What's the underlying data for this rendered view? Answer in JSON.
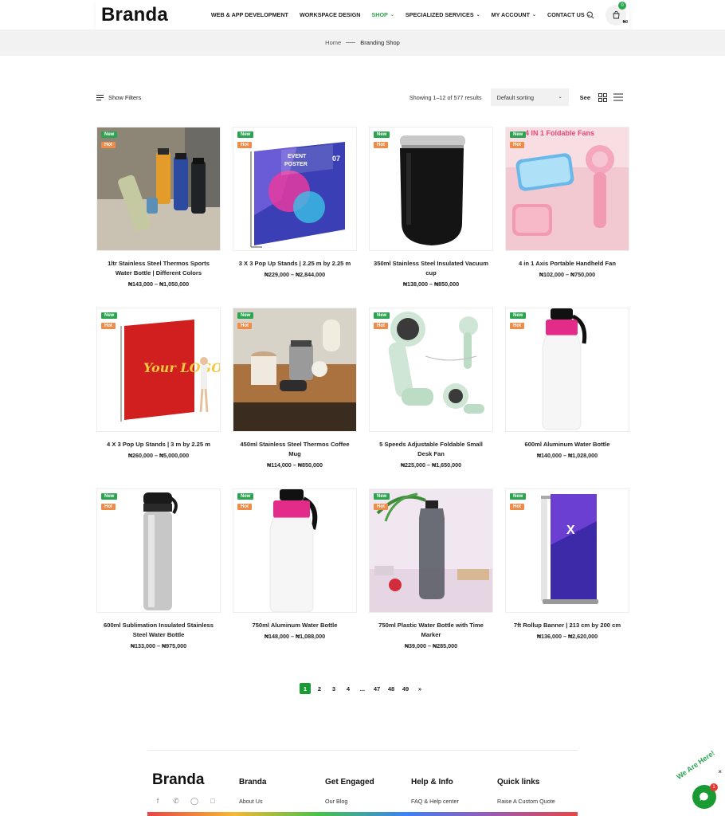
{
  "header": {
    "logo": "Branda",
    "nav": [
      {
        "label": "WEB & APP DEVELOPMENT",
        "dropdown": false,
        "active": false
      },
      {
        "label": "WORKSPACE DESIGN",
        "dropdown": false,
        "active": false
      },
      {
        "label": "SHOP",
        "dropdown": true,
        "active": true
      },
      {
        "label": "SPECIALIZED SERVICES",
        "dropdown": true,
        "active": false
      },
      {
        "label": "MY ACCOUNT",
        "dropdown": true,
        "active": false
      },
      {
        "label": "CONTACT US",
        "dropdown": true,
        "active": false
      }
    ],
    "cart_count": "0",
    "cart_currency": "₦0"
  },
  "breadcrumb": {
    "home": "Home",
    "current": "Branding Shop"
  },
  "toolbar": {
    "filters_label": "Show Filters",
    "result_count": "Showing 1–12 of 577 results",
    "sort_selected": "Default sorting",
    "see_label": "See"
  },
  "products": [
    {
      "name": "1ltr Stainless Steel Thermos Sports Water Bottle | Different Colors",
      "price": "₦143,000 – ₦1,050,000",
      "image": "thermos-bottles-photo"
    },
    {
      "name": "3 X 3 Pop Up Stands | 2.25 m by 2.25 m",
      "price": "₦229,000 – ₦2,844,000",
      "image": "event-poster-stand"
    },
    {
      "name": "350ml Stainless Steel Insulated Vacuum cup",
      "price": "₦138,000 – ₦850,000",
      "image": "black-tumbler"
    },
    {
      "name": "4 in 1 Axis Portable Handheld Fan",
      "price": "₦102,000 – ₦750,000",
      "image": "pink-fan-promo"
    },
    {
      "name": "4 X 3 Pop Up Stands | 3 m by 2.25 m",
      "price": "₦260,000 – ₦5,000,000",
      "image": "red-backdrop-stand"
    },
    {
      "name": "450ml Stainless Steel Thermos Coffee Mug",
      "price": "₦114,000 – ₦850,000",
      "image": "coffee-mug-photo"
    },
    {
      "name": "5 Speeds Adjustable Foldable Small Desk Fan",
      "price": "₦225,000 – ₦1,650,000",
      "image": "mint-desk-fan"
    },
    {
      "name": "600ml Aluminum Water Bottle",
      "price": "₦140,000 – ₦1,028,000",
      "image": "white-sports-bottle"
    },
    {
      "name": "600ml Sublimation Insulated Stainless Steel Water Bottle",
      "price": "₦133,000 – ₦975,000",
      "image": "silver-bottle"
    },
    {
      "name": "750ml Aluminum Water Bottle",
      "price": "₦148,000 – ₦1,088,000",
      "image": "white-sports-bottle-2"
    },
    {
      "name": "750ml Plastic Water Bottle with Time Marker",
      "price": "₦39,000 – ₦285,000",
      "image": "plastic-bottle-photo"
    },
    {
      "name": "7ft Rollup Banner | 213 cm by 200 cm",
      "price": "₦136,000 – ₦2,620,000",
      "image": "rollup-banner"
    }
  ],
  "badges": {
    "new": "New",
    "hot": "Hot"
  },
  "poster_text": {
    "event": "EVENT",
    "poster": "POSTER",
    "num": "07",
    "yourlogo": "Your LOGO",
    "fans": "4 IN 1 Foldable Fans"
  },
  "pagination": [
    "1",
    "2",
    "3",
    "4",
    "...",
    "47",
    "48",
    "49",
    "»"
  ],
  "footer": {
    "logo": "Branda",
    "columns": [
      {
        "title": "Branda",
        "link": "About Us"
      },
      {
        "title": "Get Engaged",
        "link": "Our Blog"
      },
      {
        "title": "Help & Info",
        "link": "FAQ & Help center"
      },
      {
        "title": "Quick links",
        "link": "Raise A Custom Quote"
      }
    ]
  },
  "chat": {
    "label": "We Are Here!",
    "count": "1",
    "close": "×"
  },
  "colors": {
    "accent": "#2aa44f",
    "hot": "#f08c4a",
    "page_current": "#1a9a33"
  }
}
